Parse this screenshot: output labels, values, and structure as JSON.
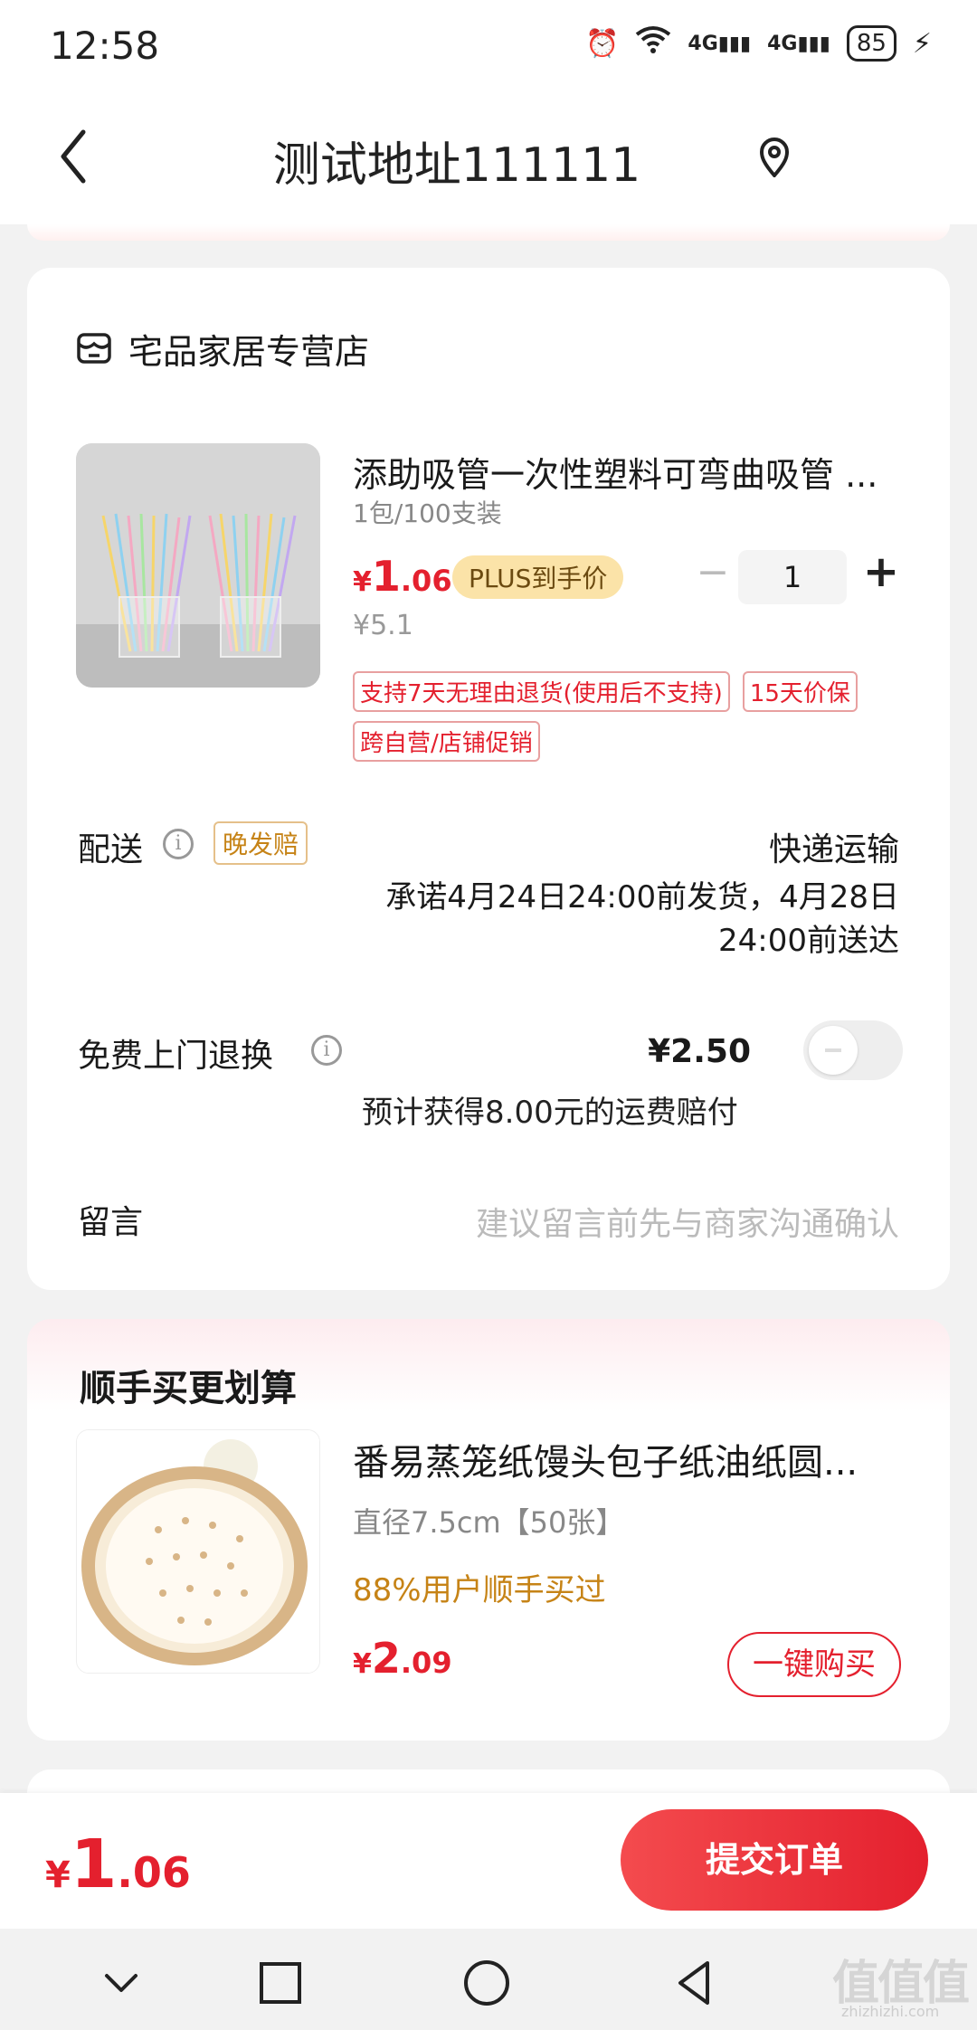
{
  "status_bar": {
    "time": "12:58",
    "signal_1": "4G",
    "signal_2": "4G",
    "battery": "85"
  },
  "header": {
    "title": "测试地址111111",
    "back_icon": "chevron-left-icon",
    "location_icon": "location-pin-icon"
  },
  "store": {
    "name": "宅品家居专营店",
    "icon": "store-icon"
  },
  "product": {
    "title": "添助吸管一次性塑料可弯曲吸管 ...",
    "spec": "1包/100支装",
    "price_currency": "¥",
    "price_int": "1",
    "price_dec": ".06",
    "price_tag": "PLUS到手价",
    "original_price": "¥5.1",
    "quantity": "1",
    "tags": [
      "支持7天无理由退货(使用后不支持)",
      "15天价保",
      "跨自营/店铺促销"
    ]
  },
  "delivery": {
    "label": "配送",
    "late_tag": "晚发赔",
    "method": "快递运输",
    "promise": "承诺4月24日24:00前发货，4月28日24:00前送达"
  },
  "free_return": {
    "label": "免费上门退换",
    "fee": "¥2.50",
    "compensation": "预计获得8.00元的运费赔付",
    "enabled": false
  },
  "message": {
    "label": "留言",
    "placeholder": "建议留言前先与商家沟通确认"
  },
  "recommend": {
    "section_title": "顺手买更划算",
    "title": "番易蒸笼纸馒头包子纸油纸圆...",
    "spec": "直径7.5cm【50张】",
    "rate": "88%用户顺手买过",
    "price_currency": "¥",
    "price_int": "2",
    "price_dec": ".09",
    "buy_label": "一键购买"
  },
  "bottom": {
    "total_currency": "¥",
    "total_int": "1",
    "total_dec": ".06",
    "submit_label": "提交订单"
  },
  "nav": {
    "icons": [
      "chevron-down-icon",
      "square-icon",
      "circle-icon",
      "triangle-back-icon"
    ]
  },
  "watermark": {
    "text": "值值值",
    "sub": "zhizhizhi.com"
  }
}
